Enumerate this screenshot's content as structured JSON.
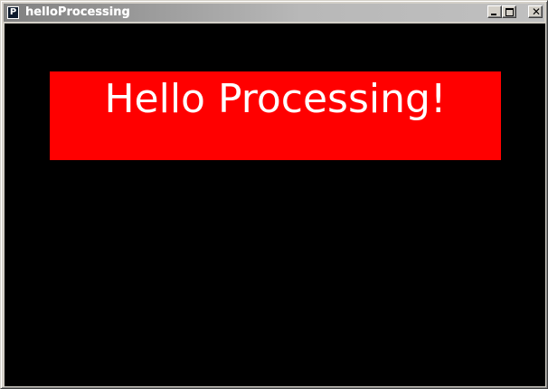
{
  "window": {
    "title": "helloProcessing",
    "icon_letter": "P",
    "icon_name": "processing-app-icon",
    "controls": {
      "minimize_icon": "minimize-icon",
      "maximize_icon": "maximize-icon",
      "close_icon": "close-icon",
      "close_glyph": "✕"
    }
  },
  "canvas": {
    "background_color": "#000000",
    "banner": {
      "text": "Hello Processing!",
      "background_color": "#ff0000",
      "text_color": "#ffffff"
    }
  }
}
